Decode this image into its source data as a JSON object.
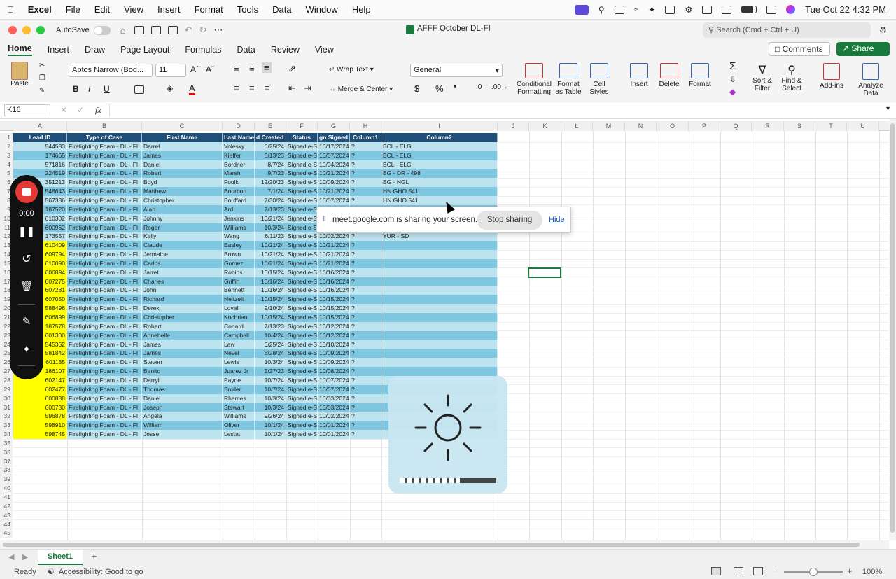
{
  "menubar": {
    "app": "Excel",
    "items": [
      "File",
      "Edit",
      "View",
      "Insert",
      "Format",
      "Tools",
      "Data",
      "Window",
      "Help"
    ],
    "clock": "Tue Oct 22  4:32 PM"
  },
  "titlebar": {
    "autosave": "AutoSave",
    "doc_title": "AFFF October DL-FI",
    "search_placeholder": "Search (Cmd + Ctrl + U)"
  },
  "ribbon_tabs": [
    "Home",
    "Insert",
    "Draw",
    "Page Layout",
    "Formulas",
    "Data",
    "Review",
    "View"
  ],
  "ribbon": {
    "paste": "Paste",
    "font_name": "Aptos Narrow (Bod...",
    "font_size": "11",
    "wrap_text": "Wrap Text",
    "merge_center": "Merge & Center",
    "number_format": "General",
    "cond_format": "Conditional Formatting",
    "format_table": "Format as Table",
    "cell_styles": "Cell Styles",
    "insert": "Insert",
    "delete": "Delete",
    "format": "Format",
    "sort_filter": "Sort & Filter",
    "find_select": "Find & Select",
    "addins": "Add-ins",
    "analyze": "Analyze Data",
    "comments": "Comments",
    "share": "Share",
    "bold": "B",
    "italic": "I",
    "underline": "U",
    "currency": "$",
    "percent": "%"
  },
  "formula_bar": {
    "name_box": "K16",
    "fx": "fx",
    "value": ""
  },
  "columns": [
    "A",
    "B",
    "C",
    "D",
    "E",
    "F",
    "G",
    "H",
    "I",
    "J",
    "K",
    "L",
    "M",
    "N",
    "O",
    "P",
    "Q",
    "R",
    "S",
    "T",
    "U"
  ],
  "table_headers": [
    "Lead ID",
    "Type of Case",
    "First Name",
    "Last Name",
    "d Created D",
    "Status",
    "gn Signed",
    "Column1",
    "Column2"
  ],
  "rows": [
    {
      "id": "544583",
      "type": "Firefighting Foam - DL - Fl",
      "first": "Darrel",
      "last": "Volesky",
      "created": "6/25/24",
      "status": "Signed e-S",
      "signed": "10/17/2024",
      "c1": "?",
      "c2": "BCL - ELG",
      "yellow": false
    },
    {
      "id": "174665",
      "type": "Firefighting Foam - DL - Fl",
      "first": "James",
      "last": "Kieffer",
      "created": "6/13/23",
      "status": "Signed e-S",
      "signed": "10/07/2024",
      "c1": "?",
      "c2": "BCL - ELG",
      "yellow": false
    },
    {
      "id": "571816",
      "type": "Firefighting Foam - DL - Fl",
      "first": "Daniel",
      "last": "Bordner",
      "created": "8/7/24",
      "status": "Signed e-S",
      "signed": "10/04/2024",
      "c1": "?",
      "c2": "BCL - ELG",
      "yellow": false
    },
    {
      "id": "224519",
      "type": "Firefighting Foam - DL - Fl",
      "first": "Robert",
      "last": "Marsh",
      "created": "9/7/23",
      "status": "Signed e-S",
      "signed": "10/21/2024",
      "c1": "?",
      "c2": "BG - DR - 498",
      "yellow": false
    },
    {
      "id": "351213",
      "type": "Firefighting Foam - DL - Fl",
      "first": "Boyd",
      "last": "Foulk",
      "created": "12/20/23",
      "status": "Signed e-S",
      "signed": "10/09/2024",
      "c1": "?",
      "c2": "BG - NGL",
      "yellow": false
    },
    {
      "id": "548643",
      "type": "Firefighting Foam - DL - Fl",
      "first": "Matthew",
      "last": "Bourbon",
      "created": "7/1/24",
      "status": "Signed e-S",
      "signed": "10/21/2024",
      "c1": "?",
      "c2": "HN GHO 541",
      "yellow": false
    },
    {
      "id": "567386",
      "type": "Firefighting Foam - DL - Fl",
      "first": "Christopher",
      "last": "Bouffard",
      "created": "7/30/24",
      "status": "Signed e-S",
      "signed": "10/07/2024",
      "c1": "?",
      "c2": "HN GHO 541",
      "yellow": false
    },
    {
      "id": "187520",
      "type": "Firefighting Foam - DL - Fl",
      "first": "Alan",
      "last": "Ard",
      "created": "7/13/23",
      "status": "Signed e-S",
      "signed": "",
      "c1": "",
      "c2": "",
      "yellow": false
    },
    {
      "id": "610302",
      "type": "Firefighting Foam - DL - Fl",
      "first": "Johnny",
      "last": "Jenkins",
      "created": "10/21/24",
      "status": "Signed e-S",
      "signed": "",
      "c1": "",
      "c2": "",
      "yellow": false
    },
    {
      "id": "600962",
      "type": "Firefighting Foam - DL - Fl",
      "first": "Roger",
      "last": "Williams",
      "created": "10/3/24",
      "status": "Signed e-S",
      "signed": "",
      "c1": "",
      "c2": "",
      "yellow": false
    },
    {
      "id": "173557",
      "type": "Firefighting Foam - DL - Fl",
      "first": "Kelly",
      "last": "Wang",
      "created": "6/11/23",
      "status": "Signed e-S",
      "signed": "10/02/2024",
      "c1": "?",
      "c2": "YUR - SD",
      "yellow": false
    },
    {
      "id": "610409",
      "type": "Firefighting Foam - DL - Fl",
      "first": "Claude",
      "last": "Easley",
      "created": "10/21/24",
      "status": "Signed e-S",
      "signed": "10/21/2024",
      "c1": "?",
      "c2": "",
      "yellow": true
    },
    {
      "id": "609794",
      "type": "Firefighting Foam - DL - Fl",
      "first": "Jermaine",
      "last": "Brown",
      "created": "10/21/24",
      "status": "Signed e-S",
      "signed": "10/21/2024",
      "c1": "?",
      "c2": "",
      "yellow": true
    },
    {
      "id": "610090",
      "type": "Firefighting Foam - DL - Fl",
      "first": "Carlos",
      "last": "Gomez",
      "created": "10/21/24",
      "status": "Signed e-S",
      "signed": "10/21/2024",
      "c1": "?",
      "c2": "",
      "yellow": true
    },
    {
      "id": "606894",
      "type": "Firefighting Foam - DL - Fl",
      "first": "Jarret",
      "last": "Robins",
      "created": "10/15/24",
      "status": "Signed e-S",
      "signed": "10/16/2024",
      "c1": "?",
      "c2": "",
      "yellow": true
    },
    {
      "id": "607275",
      "type": "Firefighting Foam - DL - Fl",
      "first": "Charles",
      "last": "Griffin",
      "created": "10/16/24",
      "status": "Signed e-S",
      "signed": "10/16/2024",
      "c1": "?",
      "c2": "",
      "yellow": true
    },
    {
      "id": "607281",
      "type": "Firefighting Foam - DL - Fl",
      "first": "John",
      "last": "Bennett",
      "created": "10/16/24",
      "status": "Signed e-S",
      "signed": "10/16/2024",
      "c1": "?",
      "c2": "",
      "yellow": true
    },
    {
      "id": "607050",
      "type": "Firefighting Foam - DL - Fl",
      "first": "Richard",
      "last": "Neitzelt",
      "created": "10/15/24",
      "status": "Signed e-S",
      "signed": "10/15/2024",
      "c1": "?",
      "c2": "",
      "yellow": true
    },
    {
      "id": "588496",
      "type": "Firefighting Foam - DL - Fl",
      "first": "Derek",
      "last": "Lovell",
      "created": "9/10/24",
      "status": "Signed e-S",
      "signed": "10/15/2024",
      "c1": "?",
      "c2": "",
      "yellow": true
    },
    {
      "id": "606899",
      "type": "Firefighting Foam - DL - Fl",
      "first": "Christopher",
      "last": "Kochrian",
      "created": "10/15/24",
      "status": "Signed e-S",
      "signed": "10/15/2024",
      "c1": "?",
      "c2": "",
      "yellow": true
    },
    {
      "id": "187578",
      "type": "Firefighting Foam - DL - Fl",
      "first": "Robert",
      "last": "Conard",
      "created": "7/13/23",
      "status": "Signed e-S",
      "signed": "10/12/2024",
      "c1": "?",
      "c2": "",
      "yellow": true
    },
    {
      "id": "601300",
      "type": "Firefighting Foam - DL - Fl",
      "first": "Annebelle",
      "last": "Campbell",
      "created": "10/4/24",
      "status": "Signed e-S",
      "signed": "10/12/2024",
      "c1": "?",
      "c2": "",
      "yellow": true
    },
    {
      "id": "545362",
      "type": "Firefighting Foam - DL - Fl",
      "first": "James",
      "last": "Law",
      "created": "6/25/24",
      "status": "Signed e-S",
      "signed": "10/10/2024",
      "c1": "?",
      "c2": "",
      "yellow": true
    },
    {
      "id": "581842",
      "type": "Firefighting Foam - DL - Fl",
      "first": "James",
      "last": "Nevel",
      "created": "8/28/24",
      "status": "Signed e-S",
      "signed": "10/09/2024",
      "c1": "?",
      "c2": "",
      "yellow": true
    },
    {
      "id": "601135",
      "type": "Firefighting Foam - DL - Fl",
      "first": "Steven",
      "last": "Lewis",
      "created": "10/3/24",
      "status": "Signed e-S",
      "signed": "10/09/2024",
      "c1": "?",
      "c2": "",
      "yellow": true
    },
    {
      "id": "186107",
      "type": "Firefighting Foam - DL - Fl",
      "first": "Benito",
      "last": "Juarez Jr",
      "created": "5/27/23",
      "status": "Signed e-S",
      "signed": "10/08/2024",
      "c1": "?",
      "c2": "",
      "yellow": true
    },
    {
      "id": "602147",
      "type": "Firefighting Foam - DL - Fl",
      "first": "Darryl",
      "last": "Payne",
      "created": "10/7/24",
      "status": "Signed e-S",
      "signed": "10/07/2024",
      "c1": "?",
      "c2": "",
      "yellow": true
    },
    {
      "id": "602477",
      "type": "Firefighting Foam - DL - Fl",
      "first": "Thomas",
      "last": "Snider",
      "created": "10/7/24",
      "status": "Signed e-S",
      "signed": "10/07/2024",
      "c1": "?",
      "c2": "",
      "yellow": true
    },
    {
      "id": "600838",
      "type": "Firefighting Foam - DL - Fl",
      "first": "Daniel",
      "last": "Rhames",
      "created": "10/3/24",
      "status": "Signed e-S",
      "signed": "10/03/2024",
      "c1": "?",
      "c2": "",
      "yellow": true
    },
    {
      "id": "600730",
      "type": "Firefighting Foam - DL - Fl",
      "first": "Joseph",
      "last": "Stewart",
      "created": "10/3/24",
      "status": "Signed e-S",
      "signed": "10/03/2024",
      "c1": "?",
      "c2": "",
      "yellow": true
    },
    {
      "id": "596878",
      "type": "Firefighting Foam - DL - Fl",
      "first": "Angela",
      "last": "Williams",
      "created": "9/26/24",
      "status": "Signed e-S",
      "signed": "10/02/2024",
      "c1": "?",
      "c2": "",
      "yellow": true
    },
    {
      "id": "598910",
      "type": "Firefighting Foam - DL - Fl",
      "first": "William",
      "last": "Oliver",
      "created": "10/1/24",
      "status": "Signed e-S",
      "signed": "10/01/2024",
      "c1": "?",
      "c2": "",
      "yellow": true
    },
    {
      "id": "598745",
      "type": "Firefighting Foam - DL - Fl",
      "first": "Jesse",
      "last": "Lestat",
      "created": "10/1/24",
      "status": "Signed e-S",
      "signed": "10/01/2024",
      "c1": "?",
      "c2": "",
      "yellow": true
    }
  ],
  "row_numbers": [
    "1",
    "2",
    "3",
    "4",
    "5",
    "6",
    "7",
    "8",
    "9",
    "10",
    "11",
    "12",
    "13",
    "14",
    "15",
    "16",
    "17",
    "18",
    "19",
    "20",
    "21",
    "22",
    "23",
    "24",
    "25",
    "26",
    "27",
    "28",
    "29",
    "30",
    "31",
    "32",
    "33",
    "34",
    "35",
    "36",
    "37",
    "38",
    "39",
    "40",
    "41",
    "42",
    "43",
    "44",
    "45"
  ],
  "recorder": {
    "time": "0:00"
  },
  "share_banner": {
    "text": "meet.google.com is sharing your screen.",
    "stop": "Stop sharing",
    "hide": "Hide"
  },
  "sheet_tab": "Sheet1",
  "status": {
    "ready": "Ready",
    "accessibility": "Accessibility: Good to go",
    "zoom": "100%"
  },
  "colors": {
    "header": "#1f4e79",
    "light": "#bde3ef",
    "dark": "#7fc7e0",
    "highlight": "#ffff00",
    "accent": "#1a7a3e"
  }
}
